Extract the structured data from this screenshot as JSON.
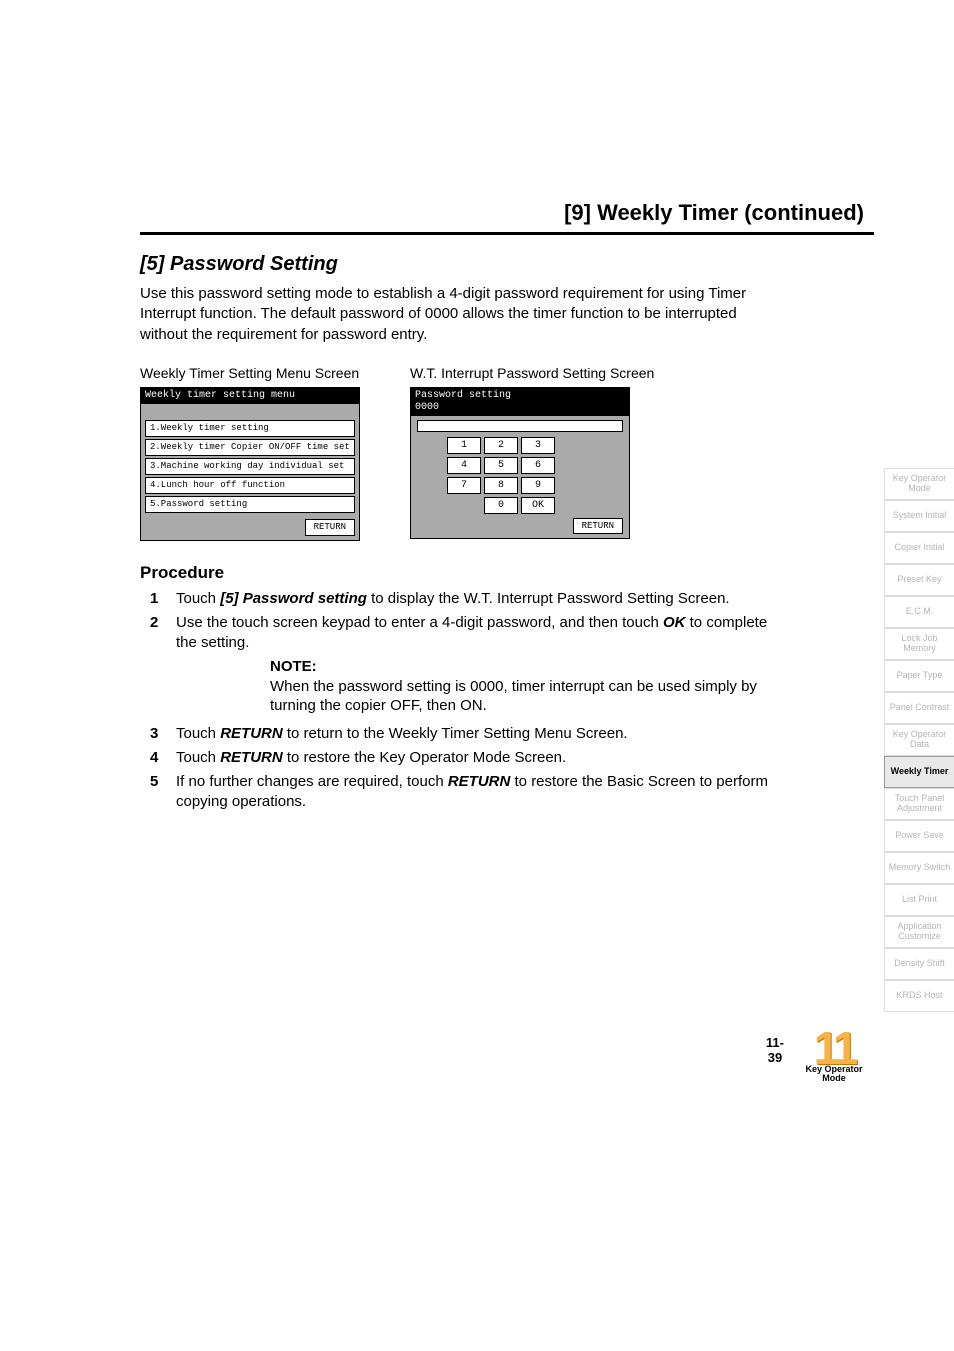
{
  "header": {
    "title": "[9] Weekly Timer (continued)"
  },
  "section": {
    "title": "[5] Password Setting",
    "intro": "Use this password setting mode to establish a 4-digit password requirement for using Timer Interrupt function. The default password of 0000 allows the timer function to be interrupted without the requirement for password entry."
  },
  "screens": {
    "menu": {
      "caption": "Weekly Timer Setting Menu Screen",
      "title": "Weekly timer setting menu",
      "items": [
        "1.Weekly timer setting",
        "2.Weekly timer Copier ON/OFF time set",
        "3.Machine working day individual set",
        "4.Lunch hour off function",
        "5.Password setting"
      ],
      "return": "RETURN"
    },
    "password": {
      "caption": "W.T. Interrupt Password Setting Screen",
      "title": "Password setting",
      "value": "0000",
      "keys": [
        "1",
        "2",
        "3",
        "4",
        "5",
        "6",
        "7",
        "8",
        "9",
        "",
        "0",
        "OK"
      ],
      "return": "RETURN"
    }
  },
  "procedure": {
    "heading": "Procedure",
    "steps": {
      "s1_pre": "Touch ",
      "s1_b": "[5] Password setting",
      "s1_post": " to display the W.T. Interrupt Password Setting Screen.",
      "s2_pre": "Use the touch screen keypad to enter a 4-digit password, and then touch ",
      "s2_b": "OK",
      "s2_post": " to complete the setting.",
      "s3_pre": "Touch ",
      "s3_b": "RETURN",
      "s3_post": " to return to the Weekly Timer Setting Menu Screen.",
      "s4_pre": "Touch ",
      "s4_b": "RETURN",
      "s4_post": " to restore the Key Operator Mode Screen.",
      "s5_pre": "If no further changes are required, touch ",
      "s5_b": "RETURN",
      "s5_post": " to restore the Basic Screen to perform copying operations."
    },
    "note_label": "NOTE:",
    "note_text": "When the password setting is 0000, timer interrupt can be used simply by turning the copier OFF, then ON."
  },
  "sidebar": {
    "tabs": [
      "Key Operator Mode",
      "System Initial",
      "Copier Initial",
      "Preset Key",
      "E.C.M.",
      "Lock Job Memory",
      "Paper Type",
      "Panel Contrast",
      "Key Operator Data",
      "Weekly Timer",
      "Touch Panel Adjustment",
      "Power Save",
      "Memory Switch",
      "List Print",
      "Application Customize",
      "Density Shift",
      "KRDS Host"
    ],
    "active_index": 9
  },
  "footer": {
    "page": "11-39",
    "chapter_num": "11",
    "chapter_label": "Key Operator Mode"
  }
}
